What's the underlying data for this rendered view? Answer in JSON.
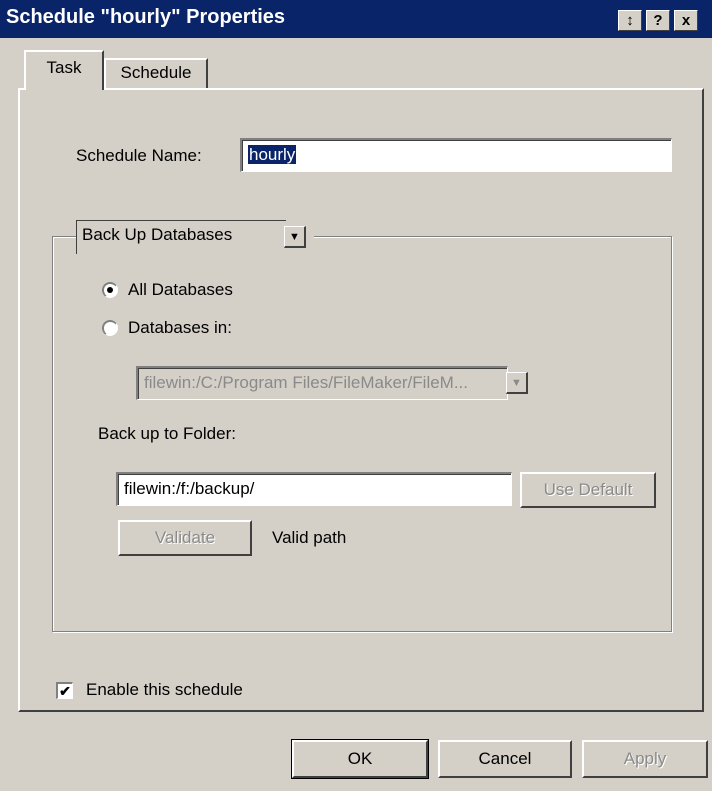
{
  "window": {
    "title": "Schedule \"hourly\" Properties",
    "context_help_glyph": "?",
    "close_glyph": "x",
    "pin_glyph": "↕"
  },
  "tabs": [
    {
      "label": "Task",
      "active": true
    },
    {
      "label": "Schedule",
      "active": false
    }
  ],
  "form": {
    "schedule_name_label": "Schedule Name:",
    "schedule_name_value": "hourly",
    "task_type": "Back Up Databases",
    "radio_all": "All Databases",
    "radio_in": "Databases in:",
    "selected_radio": "all",
    "databases_path": "filewin:/C:/Program Files/FileMaker/FileM...",
    "backup_folder_label": "Back up to Folder:",
    "backup_folder_value": "filewin:/f:/backup/",
    "use_default_label": "Use Default",
    "validate_label": "Validate",
    "validation_status": "Valid path",
    "enable_label": "Enable this schedule",
    "enable_checked": true
  },
  "buttons": {
    "ok": "OK",
    "cancel": "Cancel",
    "apply": "Apply"
  },
  "icons": {
    "dropdown_arrow": "▼",
    "check": "✔"
  },
  "colors": {
    "titlebar": "#0a246a",
    "face": "#d4d0c8",
    "disabled_text": "#8a8a8a"
  }
}
